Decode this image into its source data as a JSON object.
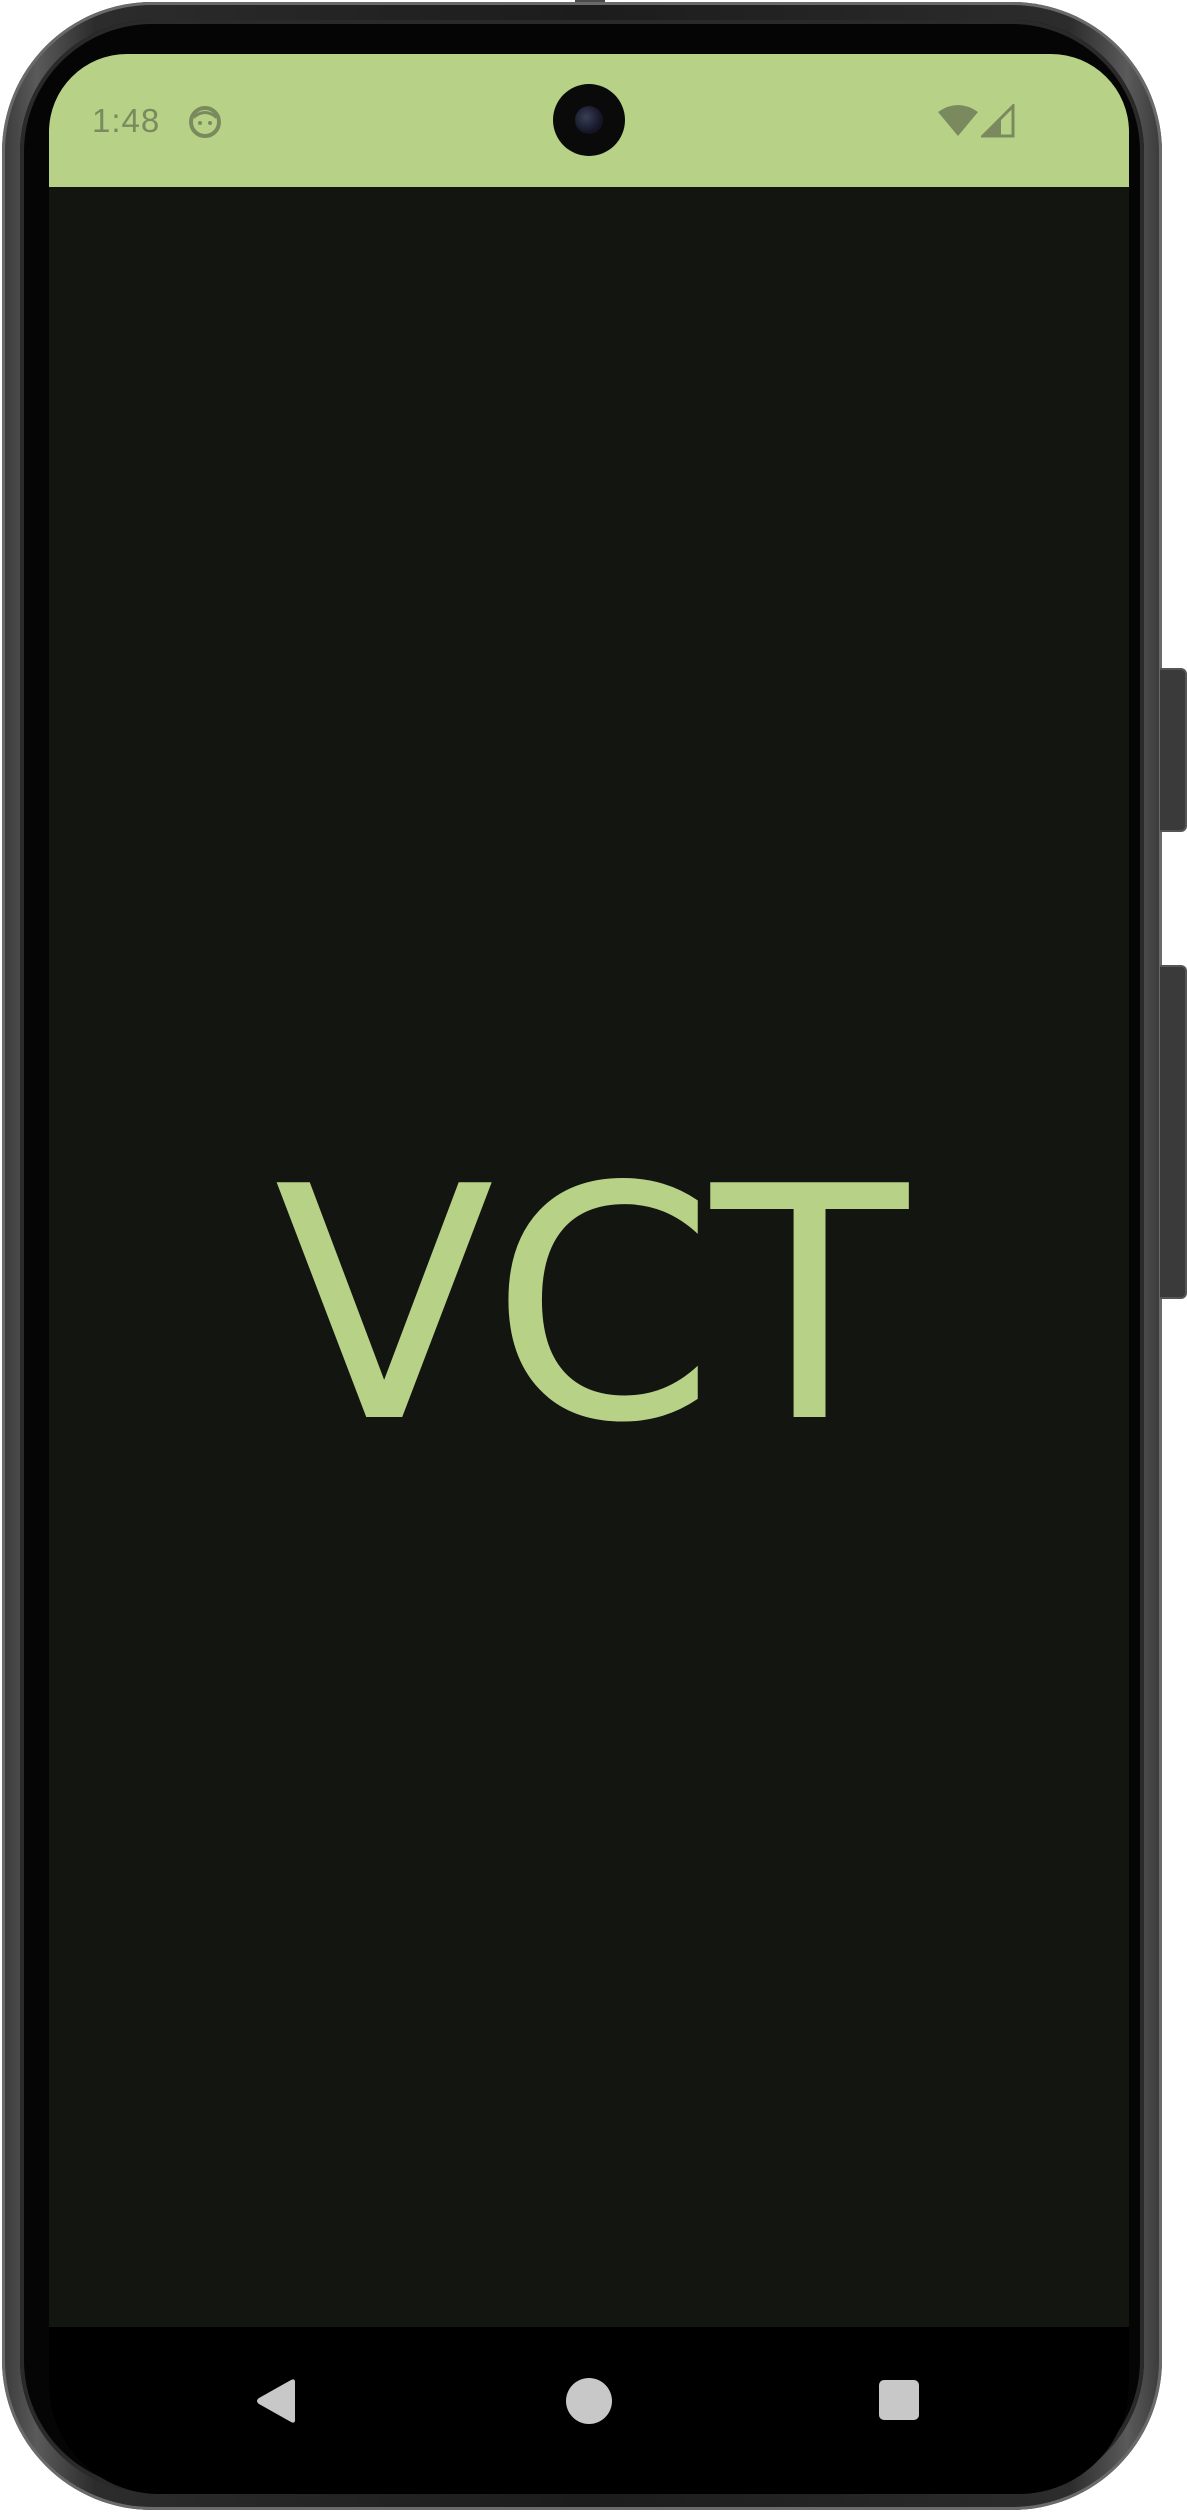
{
  "status_bar": {
    "time": "1:48",
    "background_color": "#b7d187",
    "icons": [
      "face-icon",
      "wifi-icon",
      "signal-icon"
    ]
  },
  "app": {
    "splash_text": "VCT",
    "background_color": "#131510",
    "text_color": "#b7d187"
  },
  "navigation": {
    "buttons": [
      "back-icon",
      "home-icon",
      "recents-icon"
    ]
  }
}
